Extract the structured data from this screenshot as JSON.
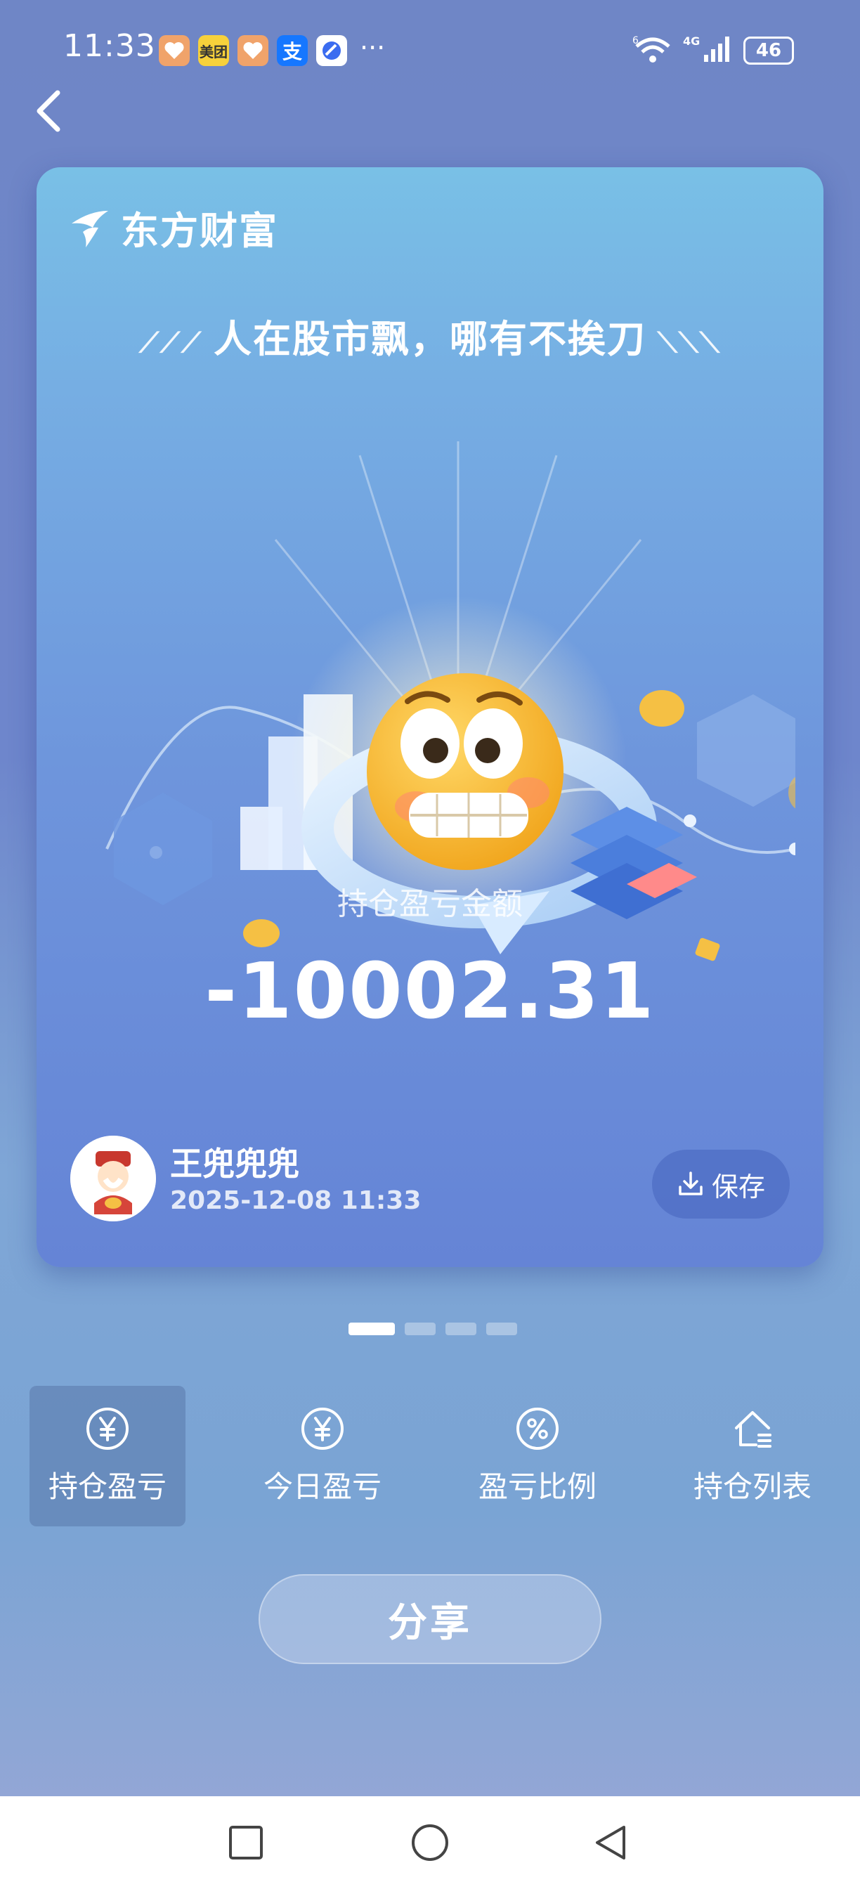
{
  "status_bar": {
    "time": "11:33",
    "apps": [
      "health-app-icon",
      "meituan-app-icon",
      "health-app-icon",
      "alipay-app-icon",
      "browser-app-icon"
    ],
    "meituan_label": "美团",
    "alipay_label": "支",
    "more": "···",
    "network_label": "4G",
    "wifi_label": "6",
    "battery": "46"
  },
  "card": {
    "brand": "东方财富",
    "slogan": "人在股市飘，哪有不挨刀",
    "pnl_label": "持仓盈亏金额",
    "pnl_value": "-10002.31",
    "user_name": "王兜兜兜",
    "timestamp": "2025-12-08 11:33",
    "save_label": "保存"
  },
  "pager": {
    "count": 4,
    "active_index": 0
  },
  "tabs": [
    {
      "label": "持仓盈亏",
      "icon": "yen-circle-icon",
      "selected": true
    },
    {
      "label": "今日盈亏",
      "icon": "yen-circle-icon",
      "selected": false
    },
    {
      "label": "盈亏比例",
      "icon": "percent-circle-icon",
      "selected": false
    },
    {
      "label": "持仓列表",
      "icon": "house-list-icon",
      "selected": false
    }
  ],
  "share_label": "分享",
  "colors": {
    "card_top": "#79c0e6",
    "card_bottom": "#6584d6",
    "emoji": "#f5b82e"
  }
}
